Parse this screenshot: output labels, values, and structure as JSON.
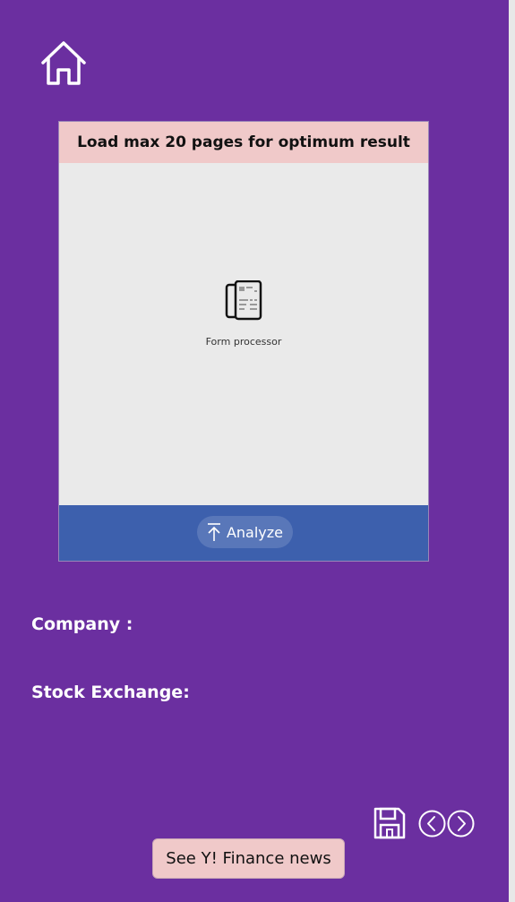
{
  "colors": {
    "background": "#6b2fa0",
    "card_header": "#f0c9c9",
    "card_body": "#eaeaea",
    "card_footer": "#3d60ad",
    "news_button": "#f0c9c9",
    "text_light": "#ffffff"
  },
  "nav": {
    "home_icon": "home-icon"
  },
  "card": {
    "header_text": "Load max 20 pages for optimum result",
    "form_icon": "form-processor-icon",
    "form_label": "Form processor",
    "analyze_label": "Analyze",
    "analyze_icon": "upload-arrow-icon"
  },
  "fields": {
    "company_label": "Company :",
    "exchange_label": "Stock Exchange:"
  },
  "footer": {
    "save_icon": "save-icon",
    "prev_icon": "chevron-left-circle-icon",
    "next_icon": "chevron-right-circle-icon",
    "news_button_label": "See Y! Finance news"
  }
}
